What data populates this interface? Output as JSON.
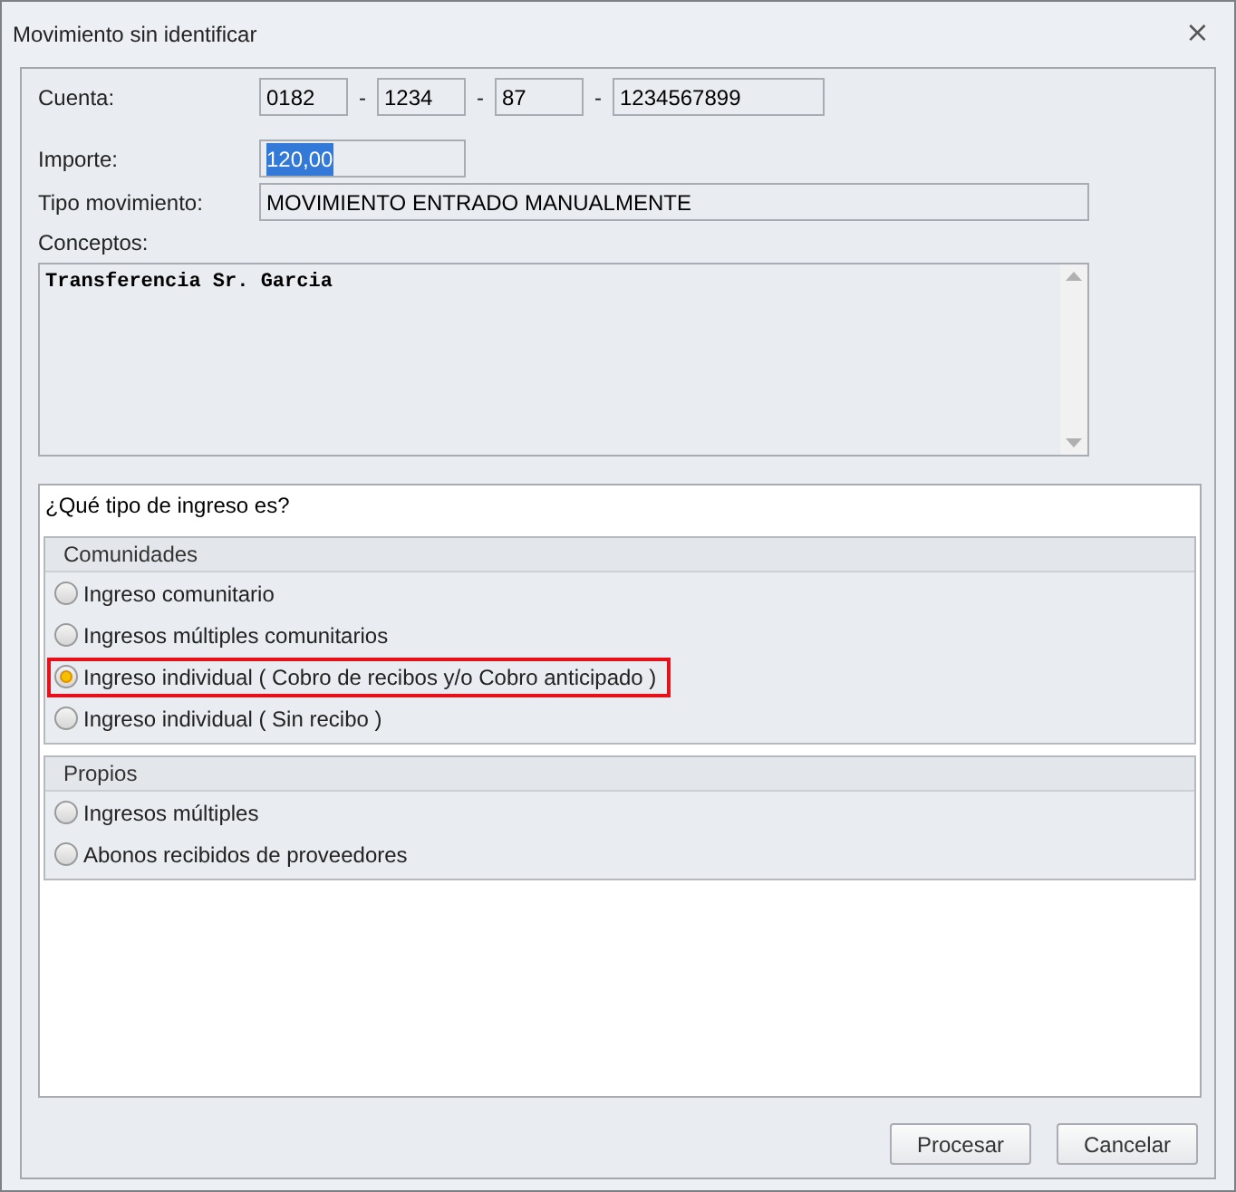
{
  "window": {
    "title": "Movimiento sin identificar",
    "close": "⨯"
  },
  "form": {
    "cuenta": {
      "label": "Cuenta:",
      "parts": [
        "0182",
        "1234",
        "87",
        "1234567899"
      ],
      "separator": "-"
    },
    "importe": {
      "label": "Importe:",
      "value": "120,00",
      "text_selected": true
    },
    "tipo": {
      "label": "Tipo movimiento:",
      "value": "MOVIMIENTO ENTRADO MANUALMENTE"
    },
    "conceptos": {
      "label": "Conceptos:",
      "value": "Transferencia Sr. Garcia"
    }
  },
  "question": {
    "title": "¿Qué tipo de ingreso es?",
    "groups": [
      {
        "title": "Comunidades",
        "options": [
          {
            "label": "Ingreso comunitario",
            "selected": false,
            "highlighted": false
          },
          {
            "label": "Ingresos múltiples comunitarios",
            "selected": false,
            "highlighted": false
          },
          {
            "label": "Ingreso individual ( Cobro de recibos y/o Cobro anticipado )",
            "selected": true,
            "highlighted": true
          },
          {
            "label": "Ingreso individual ( Sin recibo )",
            "selected": false,
            "highlighted": false
          }
        ]
      },
      {
        "title": "Propios",
        "options": [
          {
            "label": "Ingresos múltiples",
            "selected": false,
            "highlighted": false
          },
          {
            "label": "Abonos recibidos de proveedores",
            "selected": false,
            "highlighted": false
          }
        ]
      }
    ]
  },
  "buttons": [
    "Procesar",
    "Cancelar"
  ]
}
